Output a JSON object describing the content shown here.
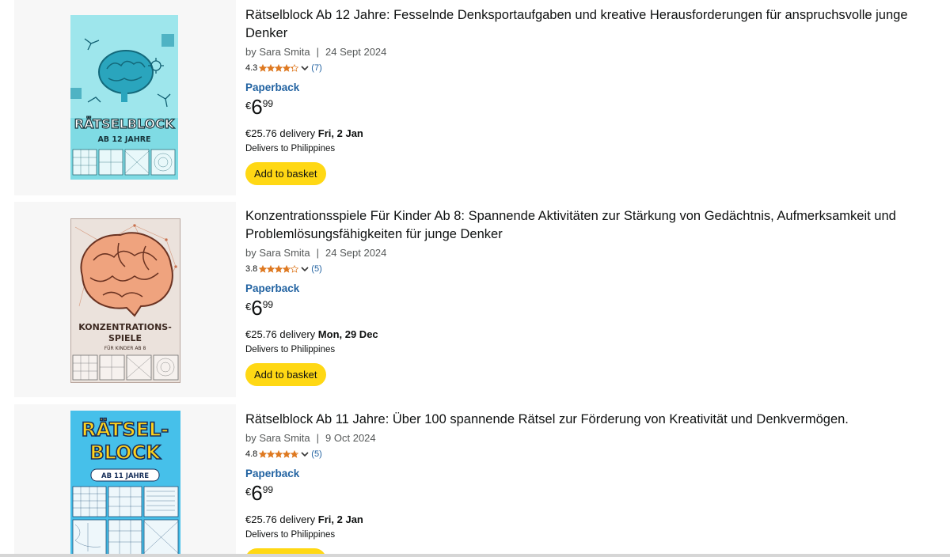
{
  "results": [
    {
      "title": "Rätselblock Ab 12 Jahre: Fesselnde Denksportaufgaben und kreative Herausforderungen für anspruchsvolle junge Denker",
      "author": "by Sara Smita",
      "date": "24 Sept 2024",
      "rating": "4.3",
      "stars": 4.3,
      "review_count": "(7)",
      "format": "Paperback",
      "price_symbol": "€",
      "price_whole": "6",
      "price_fraction": "99",
      "delivery_price": "€25.76 delivery",
      "delivery_date": "Fri, 2 Jan",
      "ships_to": "Delivers to Philippines",
      "button": "Add to basket",
      "cover_title": "RÄTSELBLOCK",
      "cover_subtitle": "AB 12 JAHRE"
    },
    {
      "title": "Konzentrationsspiele Für Kinder Ab 8: Spannende Aktivitäten zur Stärkung von Gedächtnis, Aufmerksamkeit und Problemlösungsfähigkeiten für junge Denker",
      "author": "by Sara Smita",
      "date": "24 Sept 2024",
      "rating": "3.8",
      "stars": 3.8,
      "review_count": "(5)",
      "format": "Paperback",
      "price_symbol": "€",
      "price_whole": "6",
      "price_fraction": "99",
      "delivery_price": "€25.76 delivery",
      "delivery_date": "Mon, 29 Dec",
      "ships_to": "Delivers to Philippines",
      "button": "Add to basket",
      "cover_title_1": "KONZENTRATIONS-",
      "cover_title_2": "SPIELE",
      "cover_subtitle": "FÜR KINDER AB 8"
    },
    {
      "title": "Rätselblock Ab 11 Jahre: Über 100 spannende Rätsel zur Förderung von Kreativität und Denkvermögen.",
      "author": "by Sara Smita",
      "date": "9 Oct 2024",
      "rating": "4.8",
      "stars": 4.8,
      "review_count": "(5)",
      "format": "Paperback",
      "price_symbol": "€",
      "price_whole": "6",
      "price_fraction": "99",
      "delivery_price": "€25.76 delivery",
      "delivery_date": "Fri, 2 Jan",
      "ships_to": "Delivers to Philippines",
      "button": "Add to basket",
      "cover_title_1": "RÄTSEL-",
      "cover_title_2": "BLOCK",
      "cover_subtitle": "AB 11 JAHRE"
    }
  ],
  "colors": {
    "star": "#de7921",
    "link": "#2162a1",
    "button": "#ffd814",
    "card_bg": "#f7f7f7"
  }
}
